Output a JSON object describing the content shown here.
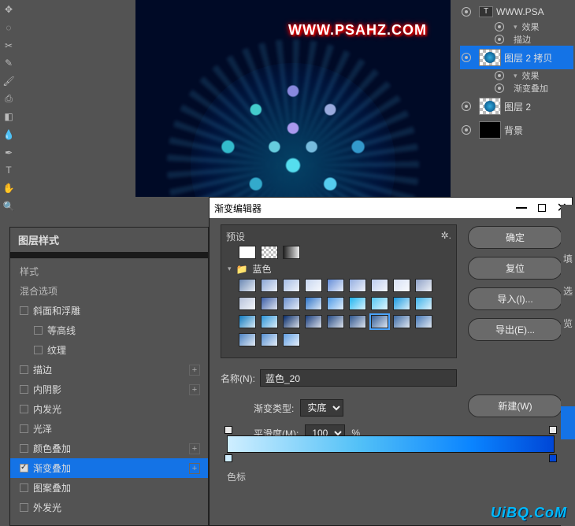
{
  "toolbar": {
    "icons": [
      "move",
      "lasso",
      "crop",
      "eyedrop",
      "brush",
      "clone",
      "eraser",
      "blur",
      "pen",
      "text",
      "hand",
      "zoom",
      "color"
    ]
  },
  "canvas": {
    "watermark": "WWW.PSAHZ.COM"
  },
  "layers": {
    "textLayer": {
      "label": "WWW.PSA",
      "hasFx": true,
      "fxLabel": "效果",
      "strokeLabel": "描边"
    },
    "layer2copy": {
      "label": "图层 2 拷贝",
      "fxLabel": "效果",
      "gradOverlayLabel": "渐变叠加"
    },
    "layer2": {
      "label": "图层 2"
    },
    "bg": {
      "label": "背景"
    }
  },
  "layerStyle": {
    "title": "图层样式",
    "stylesHeader": "样式",
    "blendOptions": "混合选项",
    "bevel": "斜面和浮雕",
    "contour": "等高线",
    "texture": "纹理",
    "stroke": "描边",
    "innerShadow": "内阴影",
    "innerGlow": "内发光",
    "satin": "光泽",
    "colorOverlay": "颜色叠加",
    "gradientOverlay": "渐变叠加",
    "patternOverlay": "图案叠加",
    "outerGlow": "外发光"
  },
  "gradEditor": {
    "title": "渐变编辑器",
    "presets": "预设",
    "folderBlue": "蓝色",
    "nameLabel": "名称(N):",
    "nameValue": "蓝色_20",
    "newBtn": "新建(W)",
    "gradType": "渐变类型:",
    "gradTypeVal": "实底",
    "smooth": "平滑度(M):",
    "smoothVal": "100",
    "percent": "%",
    "colorstops": "色标",
    "ok": "确定",
    "cancel": "复位",
    "import": "导入(I)...",
    "export": "导出(E)..."
  },
  "rstrip": {
    "items": [
      "填",
      "选",
      "览"
    ]
  },
  "logo": "UiBQ.CoM",
  "swatches": [
    "url",
    "#f5f5f5",
    "#c0d8ef",
    "#6b88b4",
    "#8aa6d6",
    "#a4bce4",
    "#c8d6f0",
    "#668ed8",
    "#94aee0",
    "#bcccee",
    "#d7e1f5",
    "#8ea1c7",
    "#b7c3db",
    "#3b5ea6",
    "#6a8fce",
    "#2e74c8",
    "#4d9ae6",
    "#1fb4f0",
    "#53c6f2",
    "#1a9ae0",
    "#3cb2ea",
    "#117abf",
    "#2b94d8",
    "#072b6a",
    "#1a3d7c",
    "#254a84",
    "#2e568e",
    "#355f98",
    "#3c6aa4",
    "#4476b4",
    "#4d82c2",
    "#5790d2",
    "#629fe3"
  ]
}
